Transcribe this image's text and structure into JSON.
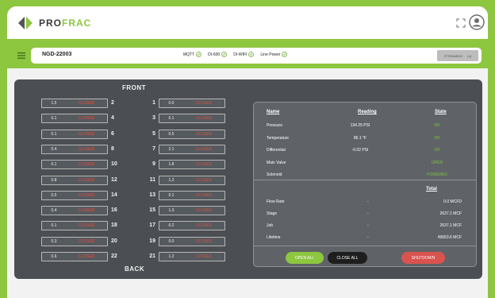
{
  "brand": {
    "pro": "PRO",
    "frac": "FRAC"
  },
  "status": {
    "well_id": "NGD-22003",
    "indicators": [
      {
        "label": "MQTT"
      },
      {
        "label": "DI-600"
      },
      {
        "label": "DI-WIFI"
      },
      {
        "label": "Line Power"
      }
    ],
    "streaming_label": "STREAMING",
    "streaming_toggle": "[••]"
  },
  "manifold": {
    "front_label": "FRONT",
    "back_label": "BACK"
  },
  "valves": [
    {
      "num": "2",
      "reading": "1.5",
      "state": "CLOSED",
      "side": "left",
      "row": 0
    },
    {
      "num": "4",
      "reading": "0.1",
      "state": "CLOSED",
      "side": "left",
      "row": 1
    },
    {
      "num": "6",
      "reading": "0.1",
      "state": "CLOSED",
      "side": "left",
      "row": 2
    },
    {
      "num": "8",
      "reading": "0.4",
      "state": "CLOSED",
      "side": "left",
      "row": 3
    },
    {
      "num": "10",
      "reading": "0.1",
      "state": "CLOSED",
      "side": "left",
      "row": 4
    },
    {
      "num": "12",
      "reading": "0.8",
      "state": "CLOSED",
      "side": "left",
      "row": 5
    },
    {
      "num": "14",
      "reading": "0.5",
      "state": "CLOSED",
      "side": "left",
      "row": 6
    },
    {
      "num": "16",
      "reading": "0.4",
      "state": "CLOSED",
      "side": "left",
      "row": 7
    },
    {
      "num": "18",
      "reading": "0.1",
      "state": "CLOSED",
      "side": "left",
      "row": 8
    },
    {
      "num": "20",
      "reading": "0.3",
      "state": "CLOSED",
      "side": "left",
      "row": 9
    },
    {
      "num": "22",
      "reading": "0.6",
      "state": "CLOSED",
      "side": "left",
      "row": 10
    },
    {
      "num": "1",
      "reading": "0.0",
      "state": "CLOSED",
      "side": "right",
      "row": 0
    },
    {
      "num": "3",
      "reading": "0.1",
      "state": "CLOSED",
      "side": "right",
      "row": 1
    },
    {
      "num": "5",
      "reading": "0.5",
      "state": "CLOSED",
      "side": "right",
      "row": 2
    },
    {
      "num": "7",
      "reading": "2.1",
      "state": "CLOSED",
      "side": "right",
      "row": 3
    },
    {
      "num": "9",
      "reading": "1.8",
      "state": "CLOSED",
      "side": "right",
      "row": 4
    },
    {
      "num": "11",
      "reading": "1.2",
      "state": "CLOSED",
      "side": "right",
      "row": 5
    },
    {
      "num": "13",
      "reading": "0.1",
      "state": "CLOSED",
      "side": "right",
      "row": 6
    },
    {
      "num": "15",
      "reading": "1.3",
      "state": "CLOSED",
      "side": "right",
      "row": 7
    },
    {
      "num": "17",
      "reading": "0.2",
      "state": "CLOSED",
      "side": "right",
      "row": 8
    },
    {
      "num": "19",
      "reading": "0.0",
      "state": "CLOSED",
      "side": "right",
      "row": 9
    },
    {
      "num": "21",
      "reading": "1.2",
      "state": "CLOSED",
      "side": "right",
      "row": 10
    }
  ],
  "info": {
    "headers": {
      "name": "Name",
      "reading": "Reading",
      "state": "State",
      "total": "Total"
    },
    "rows": [
      {
        "name": "Pressure",
        "reading": "134.25 PSI",
        "state": "OK"
      },
      {
        "name": "Temperature",
        "reading": "86.1 °F",
        "state": "OK"
      },
      {
        "name": "Differential",
        "reading": "-0.02 PSI",
        "state": "OK"
      },
      {
        "name": "Main Valve",
        "reading": "",
        "state": "OPEN"
      },
      {
        "name": "Solenoid",
        "reading": "",
        "state": "POWERED"
      }
    ],
    "totals": [
      {
        "name": "Flow Rate",
        "dash": "-",
        "value": "0.0 MCFD"
      },
      {
        "name": "Stage",
        "dash": "-",
        "value": "2637.1 MCF"
      },
      {
        "name": "Job",
        "dash": "-",
        "value": "2637.1 MCF"
      },
      {
        "name": "Lifetime",
        "dash": "-",
        "value": "49663.6 MCF"
      }
    ],
    "buttons": {
      "open_all": "OPEN ALL",
      "close_all": "CLOSE ALL",
      "shutdown": "SHUTDOWN"
    }
  },
  "colors": {
    "accent": "#8dc63f",
    "panel": "#4b4f53",
    "closed": "#e74c3c",
    "ok": "#7cc142",
    "shutdown": "#d9534f"
  }
}
